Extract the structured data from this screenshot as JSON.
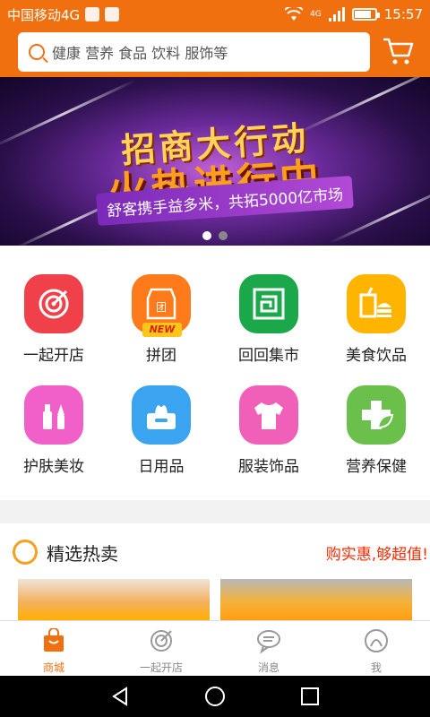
{
  "status_bar": {
    "carrier": "中国移动4G",
    "network_badge": "4G",
    "time": "15:57",
    "battery_level": 0.85
  },
  "search": {
    "placeholder": "健康 营养 食品 饮料 服饰等"
  },
  "banner": {
    "headline_1": "招商大行动",
    "headline_2": "火热进行中",
    "ribbon_text": "舒客携手益多米，共拓5000亿市场",
    "slides": 2,
    "active_slide": 1
  },
  "categories": [
    {
      "label": "一起开店",
      "icon": "target-icon",
      "color": "#f0404a"
    },
    {
      "label": "拼团",
      "icon": "group-buy-icon",
      "color": "#ff7a1a",
      "badge": "NEW"
    },
    {
      "label": "回回集市",
      "icon": "market-icon",
      "color": "#1aa84a"
    },
    {
      "label": "美食饮品",
      "icon": "food-drink-icon",
      "color": "#ffb400"
    },
    {
      "label": "护肤美妆",
      "icon": "cosmetics-icon",
      "color": "#f060c8"
    },
    {
      "label": "日用品",
      "icon": "tissue-icon",
      "color": "#3aa4f0"
    },
    {
      "label": "服装饰品",
      "icon": "shirt-icon",
      "color": "#f060b8"
    },
    {
      "label": "营养保健",
      "icon": "health-icon",
      "color": "#6ac04a"
    }
  ],
  "hot_section": {
    "title": "精选热卖",
    "slogan": "购实惠,够超值!"
  },
  "tabbar": [
    {
      "label": "商城",
      "icon": "shopping-bag-icon",
      "active": true
    },
    {
      "label": "一起开店",
      "icon": "target-icon",
      "active": false
    },
    {
      "label": "消息",
      "icon": "message-icon",
      "active": false
    },
    {
      "label": "我",
      "icon": "profile-icon",
      "active": false
    }
  ],
  "colors": {
    "brand": "#f07010",
    "slogan": "#ff2a00"
  }
}
